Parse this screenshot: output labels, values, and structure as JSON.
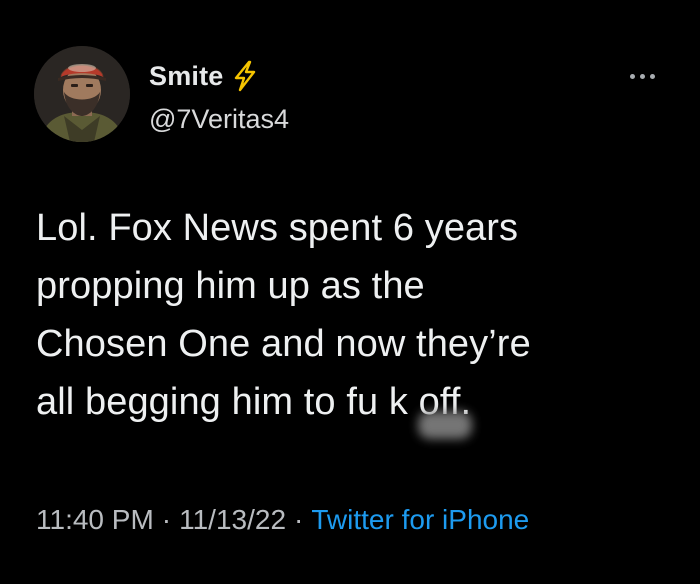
{
  "user": {
    "display_name": "Smite",
    "handle": "@7Veritas4",
    "badge_icon": "lightning-bolt-icon",
    "badge_color": "#f5c400"
  },
  "tweet": {
    "lines": [
      "Lol. Fox News spent 6 years",
      "propping him up as the",
      "Chosen One and now they’re",
      "all begging him to fu   k off."
    ]
  },
  "meta": {
    "time": "11:40 PM",
    "date": "11/13/22",
    "separator": "·",
    "source": "Twitter for iPhone"
  },
  "colors": {
    "background": "#000000",
    "text": "#e7e9ea",
    "secondary_text": "#b9bcc0",
    "link": "#1d9bf0"
  }
}
